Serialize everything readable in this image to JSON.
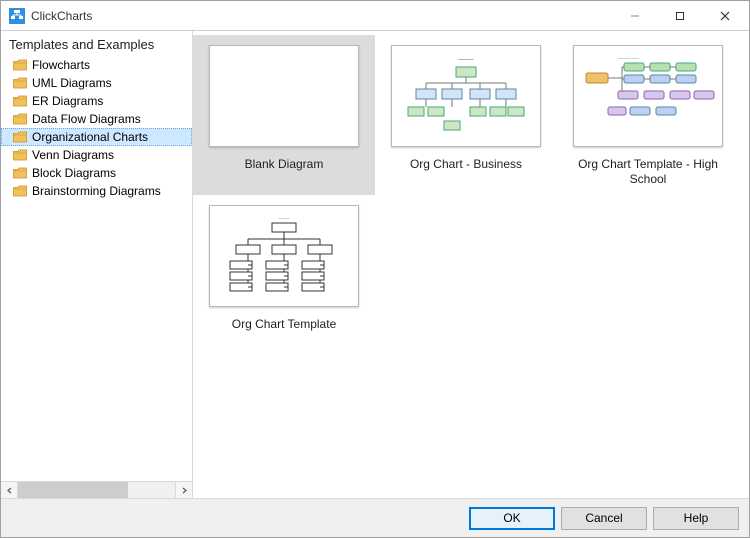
{
  "window": {
    "title": "ClickCharts"
  },
  "sidebar": {
    "header": "Templates and Examples",
    "items": [
      {
        "label": "Flowcharts"
      },
      {
        "label": "UML Diagrams"
      },
      {
        "label": "ER Diagrams"
      },
      {
        "label": "Data Flow Diagrams"
      },
      {
        "label": "Organizational Charts"
      },
      {
        "label": "Venn Diagrams"
      },
      {
        "label": "Block Diagrams"
      },
      {
        "label": "Brainstorming Diagrams"
      }
    ],
    "selected_index": 4
  },
  "gallery": {
    "items": [
      {
        "label": "Blank Diagram",
        "kind": "blank"
      },
      {
        "label": "Org Chart - Business",
        "kind": "org-business"
      },
      {
        "label": "Org Chart Template - High School",
        "kind": "org-school"
      },
      {
        "label": "Org Chart Template",
        "kind": "org-basic"
      }
    ],
    "selected_index": 0
  },
  "footer": {
    "ok": "OK",
    "cancel": "Cancel",
    "help": "Help"
  },
  "icons": {
    "folder_fill": "#f2c25a",
    "folder_stroke": "#c9922a"
  }
}
